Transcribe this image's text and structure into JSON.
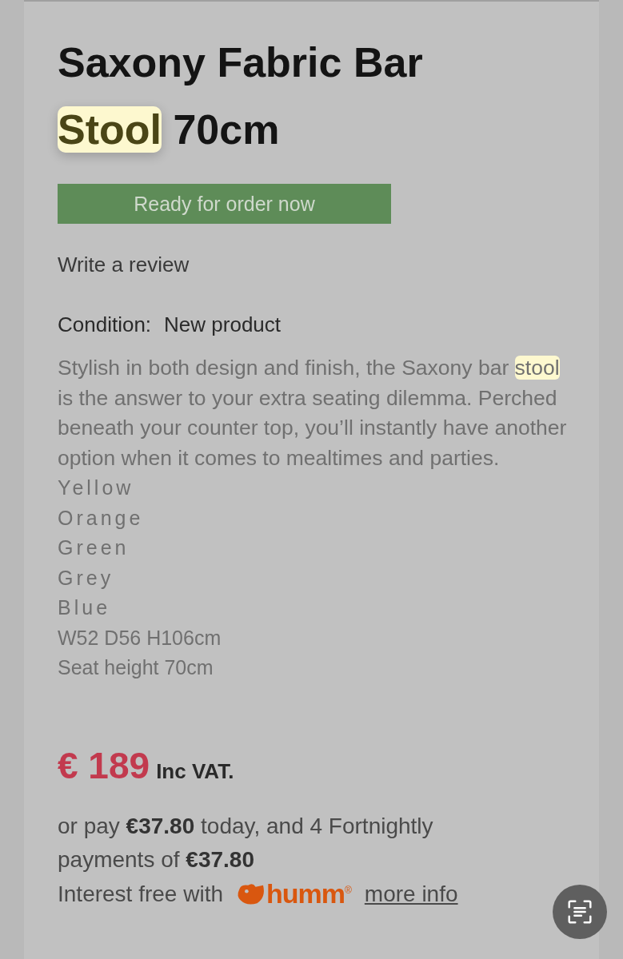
{
  "title": [
    {
      "text": "Saxony Fabric Bar ",
      "highlighted": false
    },
    {
      "text": "Stool",
      "highlighted": true
    },
    {
      "text": " 70cm",
      "highlighted": false
    }
  ],
  "availability": "Ready for order now",
  "review_link": "Write a review",
  "condition": {
    "label": "Condition:",
    "value": "New product"
  },
  "description": [
    {
      "text": "Stylish in both design and finish, the Saxony bar ",
      "highlighted": false
    },
    {
      "text": "stool",
      "highlighted": true
    },
    {
      "text": " is the answer to your extra seating dilemma. Perched beneath your counter top, you’ll instantly have another option when it comes to mealtimes and parties.",
      "highlighted": false
    }
  ],
  "colours": [
    "Yellow",
    "Orange",
    "Green",
    "Grey",
    "Blue"
  ],
  "specs": [
    "W52 D56 H106cm",
    "Seat height 70cm"
  ],
  "price": {
    "amount": "€ 189",
    "note": "Inc VAT."
  },
  "instalments": "or pay **€37.80** today, and 4 Fortnightly payments of **€37.80**",
  "financing": {
    "text": "Interest free with",
    "brand": "humm",
    "brand_mark": "®",
    "link": "more info"
  }
}
